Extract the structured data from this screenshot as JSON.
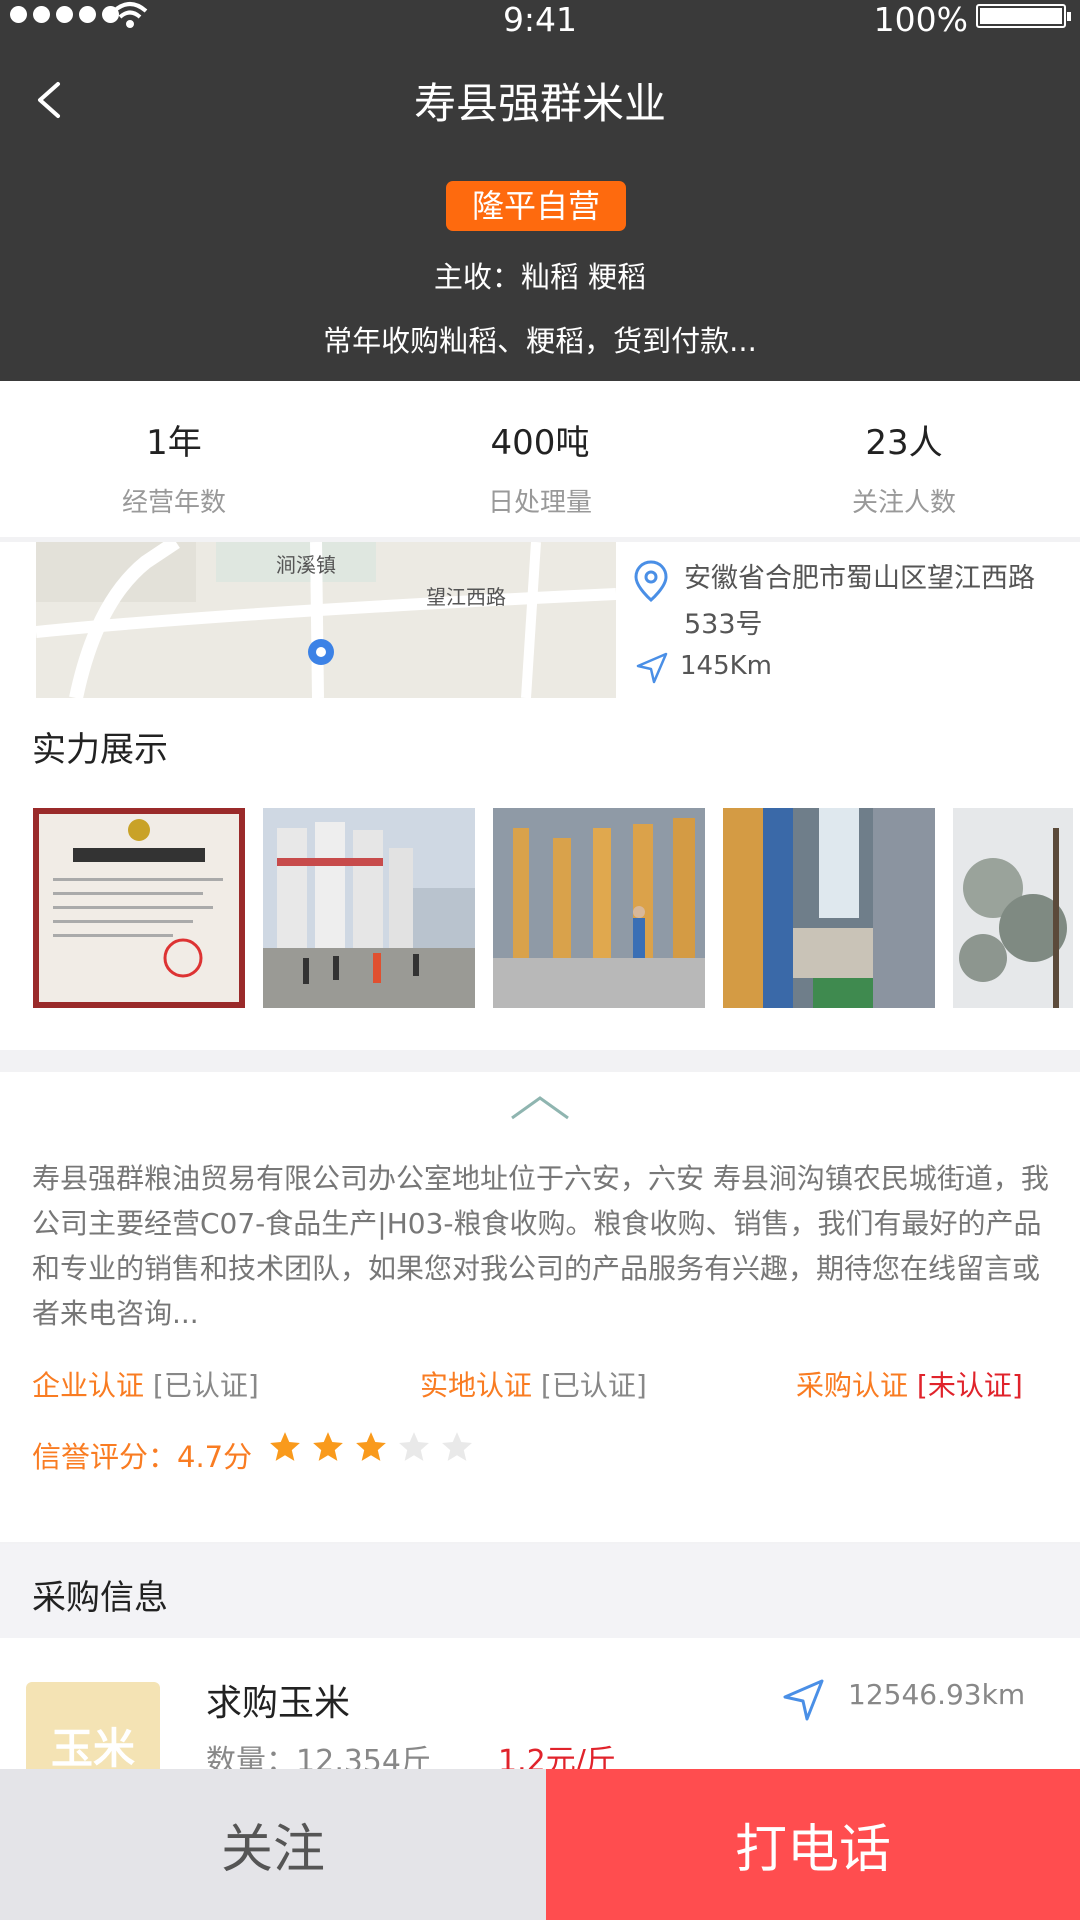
{
  "status_bar": {
    "time": "9:41",
    "battery": "100%"
  },
  "header": {
    "title": "寿县强群米业",
    "badge": "隆平自营",
    "main_crop": "主收：籼稻  粳稻",
    "short_desc": "常年收购籼稻、粳稻，货到付款..."
  },
  "stats": [
    {
      "value": "1年",
      "label": "经营年数"
    },
    {
      "value": "400吨",
      "label": "日处理量"
    },
    {
      "value": "23人",
      "label": "关注人数"
    }
  ],
  "location": {
    "address": "安徽省合肥市蜀山区望江西路533号",
    "distance": "145Km",
    "map_labels": {
      "town": "涧溪镇",
      "road": "望江西路"
    }
  },
  "strength": {
    "title": "实力展示",
    "photos": [
      "营业执照",
      "粮仓外景",
      "烘干车间",
      "设备",
      "树林"
    ]
  },
  "about": {
    "text": "寿县强群粮油贸易有限公司办公室地址位于六安，六安 寿县涧沟镇农民城街道，我公司主要经营C07-食品生产|H03-粮食收购。粮食收购、销售，我们有最好的产品和专业的销售和技术团队，如果您对我公司的产品服务有兴趣，期待您在线留言或者来电咨询...",
    "certs": [
      {
        "name": "企业认证",
        "state": "[已认证]"
      },
      {
        "name": "实地认证",
        "state": "[已认证]"
      },
      {
        "name": "采购认证",
        "state": "[未认证]"
      }
    ],
    "rating_text": "信誉评分：4.7分",
    "stars": 3,
    "stars_max": 5
  },
  "purchase": {
    "title": "采购信息",
    "item": {
      "thumb_label": "玉米",
      "title": "求购玉米",
      "qty": "数量：12,354斤",
      "price": "1.2元/斤",
      "distance": "12546.93km"
    }
  },
  "actions": {
    "follow": "关注",
    "call": "打电话"
  },
  "colors": {
    "accent": "#fe6a0e",
    "call": "#ff4d4f",
    "header": "#3a3a3a"
  }
}
